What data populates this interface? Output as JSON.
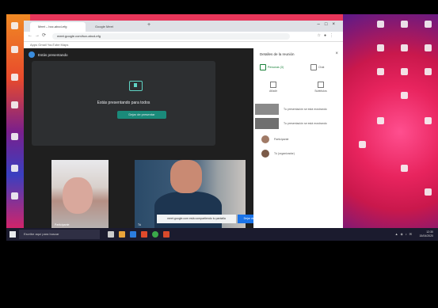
{
  "browser": {
    "tabs": [
      {
        "label": "Meet – bzz-abcd-efg"
      },
      {
        "label": "Google Meet"
      }
    ],
    "url": "meet.google.com/bzz-abcd-efg",
    "bookmarks": "Apps  Gmail  YouTube  Maps"
  },
  "meet": {
    "header": "Estás presentando",
    "present_title": "Estás presentando para todos",
    "present_button": "Dejar de presentar",
    "tile1_name": "Participante",
    "tile2_name": "Tú",
    "notice_text": "meet.google.com está compartiendo tu pantalla",
    "notice_button": "Dejar de compartir"
  },
  "panel": {
    "title": "Detalles de la reunión",
    "close": "×",
    "tab_people": "Personas (3)",
    "tab_chat": "Chat",
    "btn_add": "Añadir",
    "btn_subtitles": "Subtítulos",
    "messages": [
      {
        "text": "Tu presentación se está mostrando"
      },
      {
        "text": "Tu presentación se está mostrando"
      }
    ],
    "people": [
      {
        "name": "Participante"
      },
      {
        "name": "Tú (organizador)"
      }
    ]
  },
  "taskbar": {
    "search_placeholder": "Escribe aquí para buscar",
    "time": "12:30",
    "date": "15/04/2020"
  }
}
